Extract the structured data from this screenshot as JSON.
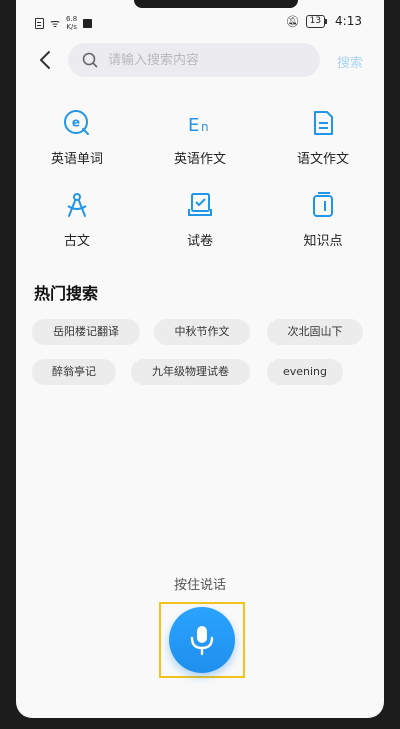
{
  "status_bar": {
    "network_speed": "6.8\nK/s",
    "battery": "13",
    "time": "4:13"
  },
  "search": {
    "placeholder": "请输入搜索内容",
    "button_label": "搜索"
  },
  "categories": [
    {
      "label": "英语单词",
      "icon": "e-circle-icon"
    },
    {
      "label": "英语作文",
      "icon": "en-letters-icon"
    },
    {
      "label": "语文作文",
      "icon": "document-icon"
    },
    {
      "label": "古文",
      "icon": "compass-icon"
    },
    {
      "label": "试卷",
      "icon": "exam-paper-icon"
    },
    {
      "label": "知识点",
      "icon": "notebook-icon"
    }
  ],
  "hot_search": {
    "title": "热门搜索",
    "items": [
      "岳阳楼记翻译",
      "中秋节作文",
      "次北固山下",
      "醉翁亭记",
      "九年级物理试卷",
      "evening"
    ]
  },
  "voice": {
    "hint": "按住说话"
  },
  "colors": {
    "accent": "#1f8fed",
    "icon_blue": "#2196e8",
    "highlight_frame": "#f4c21d"
  }
}
